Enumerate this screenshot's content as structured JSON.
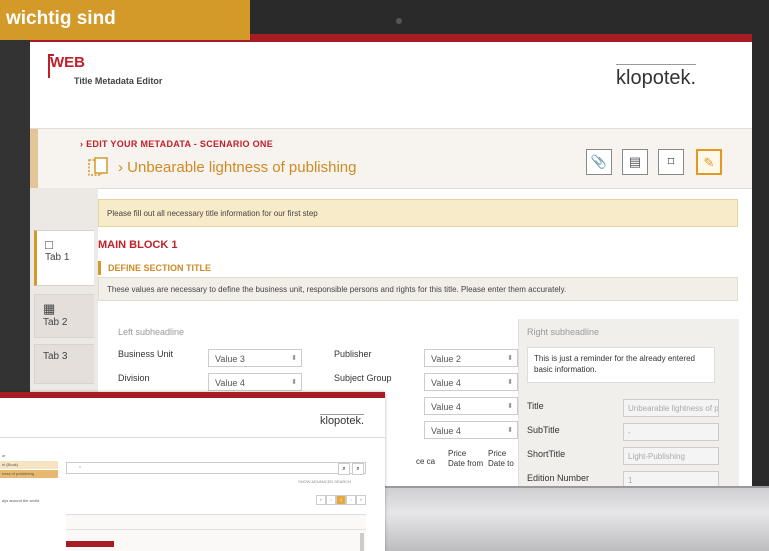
{
  "banner": {
    "text": "wichtig sind"
  },
  "app": {
    "web_label": "WEB",
    "title": "Title Metadata Editor",
    "logo": "klopotek.",
    "scenario": "› EDIT YOUR METADATA - SCENARIO ONE",
    "book_title": "› Unbearable lightness of publishing",
    "toolbar": {
      "attach": "📎",
      "card": "▤",
      "bookmark": "⌑",
      "edit": "✎"
    }
  },
  "tabs": [
    {
      "icon": "□",
      "label": "Tab 1"
    },
    {
      "icon": "▦",
      "label": "Tab 2"
    },
    {
      "icon": "",
      "label": "Tab 3"
    }
  ],
  "main": {
    "notice": "Please fill out all necessary title information for our first step",
    "block_title": "MAIN BLOCK 1",
    "section_title": "DEFINE SECTION TITLE",
    "section_desc": "These values are necessary to define the business unit, responsible persons and rights for this title. Please enter them accurately.",
    "left_subheadline": "Left subheadline",
    "right_subheadline": "Right subheadline",
    "fields": {
      "business_unit": {
        "label": "Business Unit",
        "value": "Value 3"
      },
      "division": {
        "label": "Division",
        "value": "Value 4"
      },
      "publisher": {
        "label": "Publisher",
        "value": "Value 2"
      },
      "subject_group": {
        "label": "Subject Group",
        "value": "Value 4"
      },
      "extra1": {
        "value": "Value 4"
      },
      "extra2": {
        "value": "Value 4"
      }
    },
    "price_cols": [
      "ce ca",
      "Price Date from",
      "Price Date to"
    ],
    "reminder": "This is just a reminder for the already entered basic information.",
    "right_fields": [
      {
        "label": "Title",
        "value": "Unbearable lightness of p"
      },
      {
        "label": "SubTitle",
        "value": "-"
      },
      {
        "label": "ShortTitle",
        "value": "Light-Publishing"
      },
      {
        "label": "Edition Number",
        "value": "1"
      }
    ]
  },
  "inset": {
    "logo": "klopotek.",
    "search_placeholder": "*",
    "advanced_search": "SHOW ADVANCED SEARCH",
    "list": [
      "or",
      "el (Book)",
      "ness of publishing",
      "",
      "",
      "ays around the world"
    ],
    "pages": [
      "«",
      "‹",
      "1",
      "›",
      "»"
    ]
  },
  "colors": {
    "accent": "#d39a2a",
    "brand_red": "#a61d23",
    "orange_text": "#d08a25"
  }
}
